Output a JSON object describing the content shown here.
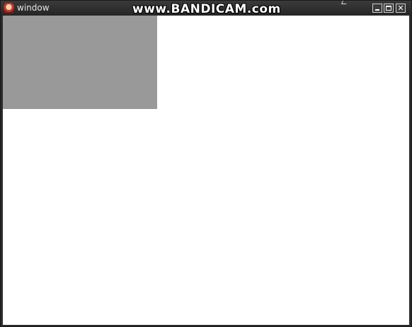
{
  "window": {
    "title": "window",
    "watermark": "www.BANDICAM.com"
  },
  "controls": {
    "minimize_icon": "minimize-icon",
    "maximize_icon": "maximize-icon",
    "close_icon": "close-icon",
    "close_glyph": "✕"
  },
  "canvas": {
    "background": "#ffffff",
    "rect_color": "#999999"
  }
}
